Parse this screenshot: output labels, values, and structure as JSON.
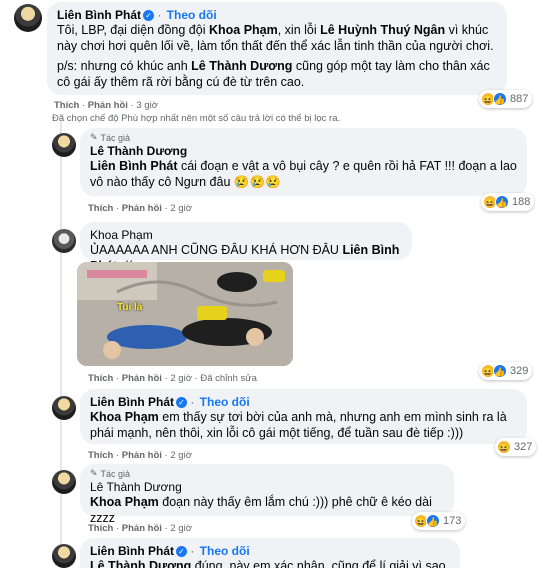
{
  "c1": {
    "name": "Liên Bình Phát",
    "follow": "Theo dõi",
    "text_parts": [
      "Tôi, LBP, đại diện đồng đội ",
      "Khoa Phạm",
      ", xin lỗi ",
      "Lê Huỳnh Thuý Ngân",
      " vì khúc này chơi hơi quên lối về, làm tổn thất đến thể xác lẫn tinh thần của người chơi."
    ],
    "text2_parts": [
      "p/s: nhưng có khúc anh ",
      "Lê Thành Dương",
      " cũng góp một tay làm cho thân xác cô gái ấy thêm rã rời bằng cú đè từ trên cao."
    ],
    "like": "Thích",
    "reply": "Phản hồi",
    "time": "3 giờ",
    "count": "887"
  },
  "filter_note": "Đã chọn chế độ Phù hợp nhất nên một số câu trả lời có thể bị lọc ra.",
  "c2": {
    "author_tag": "Tác giả",
    "name": "Lê Thành Dương",
    "text_parts": [
      "Liên Bình Phát",
      " cái đoạn e vật a vô bụi cây ? e quên rồi hả FAT !!! đoạn a lao vô nào thấy cô Ngưn đâu 😢😢😢"
    ],
    "like": "Thích",
    "reply": "Phản hồi",
    "time": "2 giờ",
    "count": "188"
  },
  "c3": {
    "name": "Khoa Phạm",
    "text_parts": [
      "ỦAAAAAA ANH CŨNG ĐÂU KHÁ HƠN ĐÂU ",
      "Liên Bình Phát",
      " :(("
    ],
    "photo_caption": "Tui là",
    "like": "Thích",
    "reply": "Phản hồi",
    "time": "2 giờ",
    "edited": "Đã chỉnh sửa",
    "count": "329"
  },
  "c4": {
    "name": "Liên Bình Phát",
    "follow": "Theo dõi",
    "text_parts": [
      "Khoa Phạm",
      " em thấy sự tơi bời của anh mà, nhưng anh em mình sinh ra là phái mạnh, nên thôi, xin lỗi cô gái một tiếng, để tuần sau đè tiếp :)))"
    ],
    "like": "Thích",
    "reply": "Phản hồi",
    "time": "2 giờ",
    "count": "327"
  },
  "c5": {
    "author_tag": "Tác giả",
    "name": "Lê Thành Dương",
    "text_parts": [
      "Khoa Phạm",
      " đoạn này thấy êm lắm chú :))) phê chữ ê kéo dài zzzz"
    ],
    "like": "Thích",
    "reply": "Phản hồi",
    "time": "2 giờ",
    "count": "173"
  },
  "c6": {
    "name": "Liên Bình Phát",
    "follow": "Theo dõi",
    "text_parts": [
      "Lê Thành Dương",
      " đúng, này em xác nhận, cũng để lí giải vì sao"
    ]
  },
  "colors": {
    "link": "#1877f2",
    "bubble": "#f0f2f5",
    "meta": "#65676b"
  }
}
